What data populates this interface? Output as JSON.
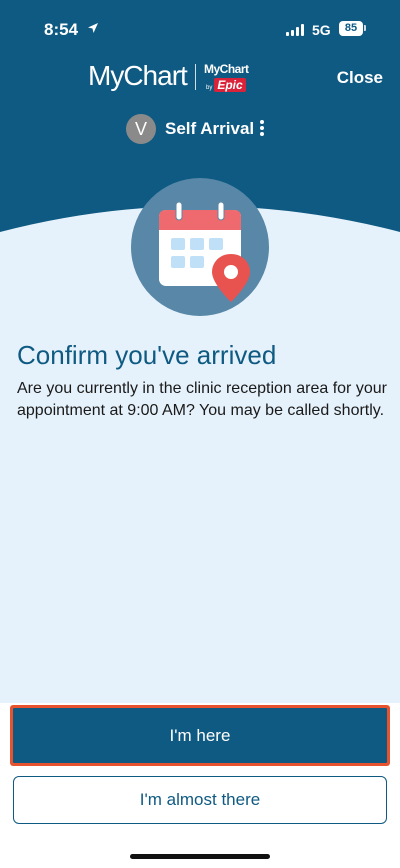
{
  "status_bar": {
    "time": "8:54",
    "network": "5G",
    "battery": "85"
  },
  "header": {
    "logo_text": "MyChart",
    "logo_sub_top": "MyChart",
    "logo_sub_by": "by",
    "logo_sub_brand": "Epic",
    "close_label": "Close",
    "avatar_initial": "V",
    "context_title": "Self Arrival"
  },
  "content": {
    "title": "Confirm you've arrived",
    "body": "Are you currently in the clinic reception area for your appointment at 9:00 AM? You may be called shortly."
  },
  "actions": {
    "primary_label": "I'm here",
    "secondary_label": "I'm almost there"
  },
  "colors": {
    "brand_blue": "#0f5a82",
    "background": "#e6f2fb",
    "highlight": "#e8532f",
    "calendar_red": "#ef6a6e",
    "pin_red": "#e8534f"
  },
  "icons": [
    "location-arrow-icon",
    "signal-icon",
    "battery-icon",
    "kebab-menu-icon",
    "calendar-location-icon"
  ]
}
